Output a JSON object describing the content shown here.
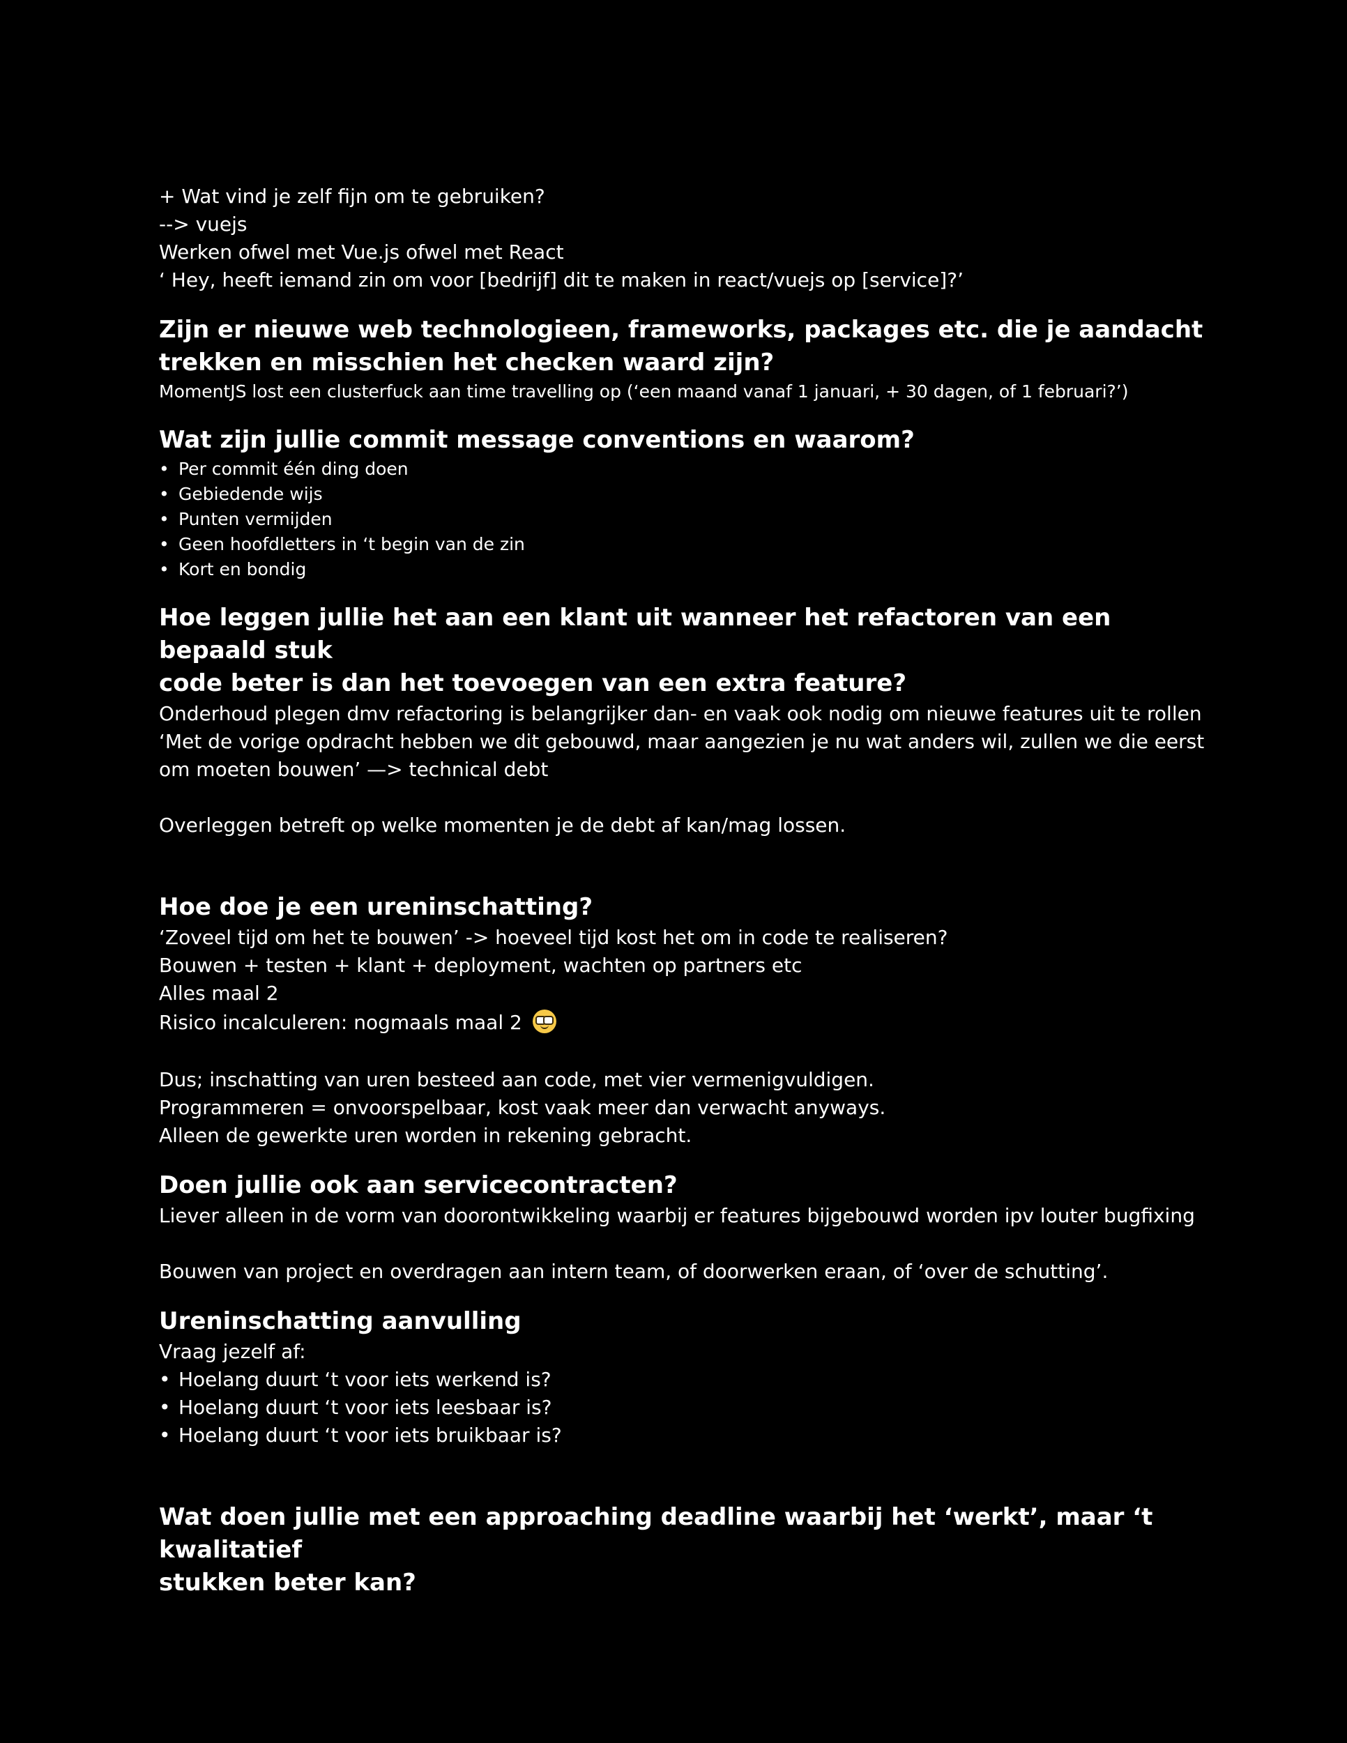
{
  "intro": {
    "lines": [
      "+ Wat vind je zelf fijn om te gebruiken?",
      "--> vuejs",
      "Werken ofwel met Vue.js ofwel met React",
      "‘ Hey, heeft iemand zin om voor [bedrijf] dit te maken in react/vuejs op [service]?’"
    ]
  },
  "section1": {
    "heading_line1": "Zijn er nieuwe web technologieen, frameworks, packages etc. die je aandacht",
    "heading_line2": "trekken en misschien het checken waard zijn?",
    "text": "MomentJS lost een clusterfuck aan time travelling op (‘een maand vanaf 1 januari, + 30 dagen, of 1 februari?’)"
  },
  "section2": {
    "heading": "Wat zijn jullie commit message conventions en waarom?",
    "bullets": [
      "Per commit één ding doen",
      "Gebiedende wijs",
      "Punten vermijden",
      "Geen hoofdletters in ‘t begin van de zin",
      "Kort en bondig"
    ]
  },
  "section3": {
    "heading_line1": "Hoe leggen jullie het aan een klant uit wanneer het refactoren van een bepaald stuk",
    "heading_line2": "code beter is dan het toevoegen van een extra feature?",
    "lines": [
      "Onderhoud plegen dmv refactoring is belangrijker dan- en vaak ook nodig om nieuwe features uit te rollen",
      "‘Met de vorige opdracht hebben we dit gebouwd, maar aangezien je nu wat anders wil,  zullen we die eerst",
      "om moeten bouwen’ —> technical debt"
    ],
    "extra": "Overleggen betreft op welke momenten je de debt af kan/mag lossen."
  },
  "section4": {
    "heading": "Hoe doe je een ureninschatting?",
    "lines": [
      "‘Zoveel tijd om het te bouwen’ -> hoeveel tijd kost het om in code te realiseren?",
      "Bouwen + testen + klant + deployment, wachten op partners etc",
      "Alles maal 2",
      "Risico incalculeren: nogmaals maal 2"
    ],
    "emoji_icon": "nerd-face-icon",
    "extra_lines": [
      "Dus; inschatting van uren besteed aan code, met vier vermenigvuldigen.",
      "Programmeren = onvoorspelbaar, kost vaak meer dan verwacht anyways.",
      "Alleen de gewerkte uren worden in rekening gebracht."
    ]
  },
  "section5": {
    "heading": "Doen jullie ook aan servicecontracten?",
    "line1": "Liever alleen in de vorm van doorontwikkeling waarbij er features bijgebouwd worden ipv louter bugfixing",
    "line2": "Bouwen van project en overdragen aan intern team, of doorwerken eraan, of ‘over de schutting’."
  },
  "section6": {
    "heading": "Ureninschatting aanvulling",
    "intro": "Vraag jezelf af:",
    "bullets": [
      "Hoelang duurt ‘t voor iets werkend is?",
      "Hoelang duurt ‘t voor iets leesbaar is?",
      "Hoelang duurt ‘t voor iets bruikbaar is?"
    ]
  },
  "section7": {
    "heading_line1": "Wat doen jullie met een approaching deadline waarbij het ‘werkt’, maar ‘t kwalitatief",
    "heading_line2": "stukken beter kan?"
  },
  "colors": {
    "background": "#000000",
    "text": "#ffffff"
  }
}
